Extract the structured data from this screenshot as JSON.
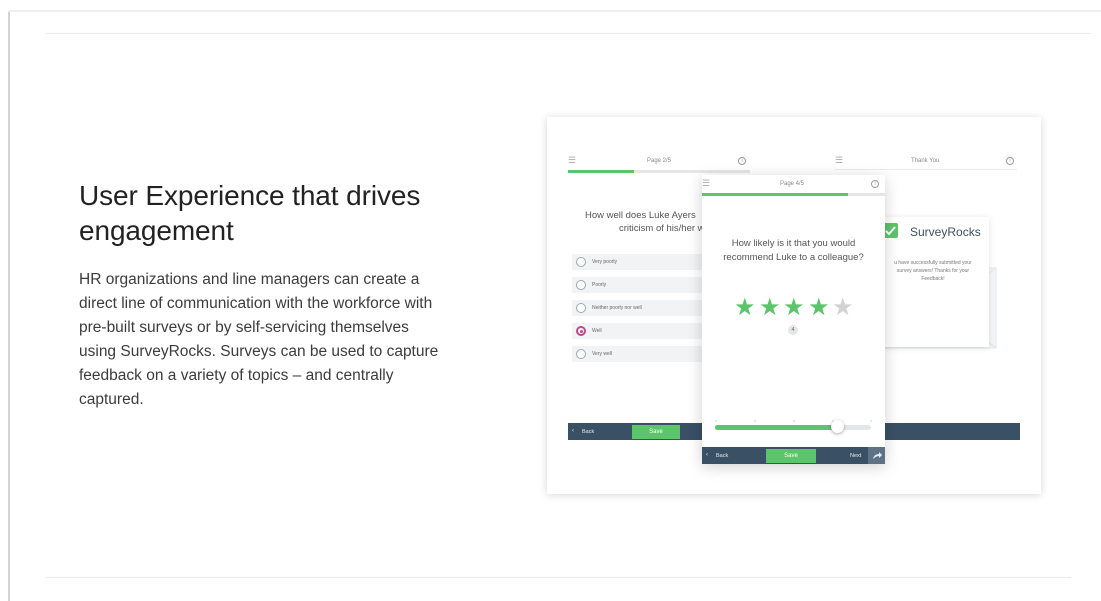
{
  "section": {
    "headline_line1": "User Experience that drives",
    "headline_line2": "engagement",
    "body_lines": [
      "HR organizations and line managers can create a",
      "direct line of communication with the workforce with",
      "pre-built surveys or by self-servicing themselves",
      "using SurveyRocks. Surveys can be used to capture",
      "feedback on a variety of topics – and centrally",
      "captured."
    ]
  },
  "screen1": {
    "page_label": "Page 2/5",
    "progress": 0.36,
    "question_line1": "How well does Luke Ayers",
    "question_line2": "criticism of his/her wo",
    "options": [
      "Very poorly",
      "Poorly",
      "Neither poorly nor well",
      "Well",
      "Very well"
    ],
    "selected_option": "Well",
    "back_label": "Back",
    "save_label": "Save"
  },
  "screen2": {
    "page_label": "Page 4/5",
    "progress": 0.8,
    "question_line1": "How likely is it that you would",
    "question_line2": "recommend Luke to a colleague?",
    "rating": 4,
    "rating_max": 5,
    "rating_value": "4",
    "slider_value": 0.78,
    "back_label": "Back",
    "save_label": "Save",
    "next_label": "Next"
  },
  "screen3": {
    "title": "Thank You",
    "brand": "SurveyRocks",
    "message_line1": "u have successfully submitted your",
    "message_line2": "survey answers! Thanks for your",
    "message_line3": "Feedback!"
  },
  "colors": {
    "accent_green": "#5cc46a",
    "nav_bar": "#3a5064",
    "selected_radio": "#c0488a"
  }
}
